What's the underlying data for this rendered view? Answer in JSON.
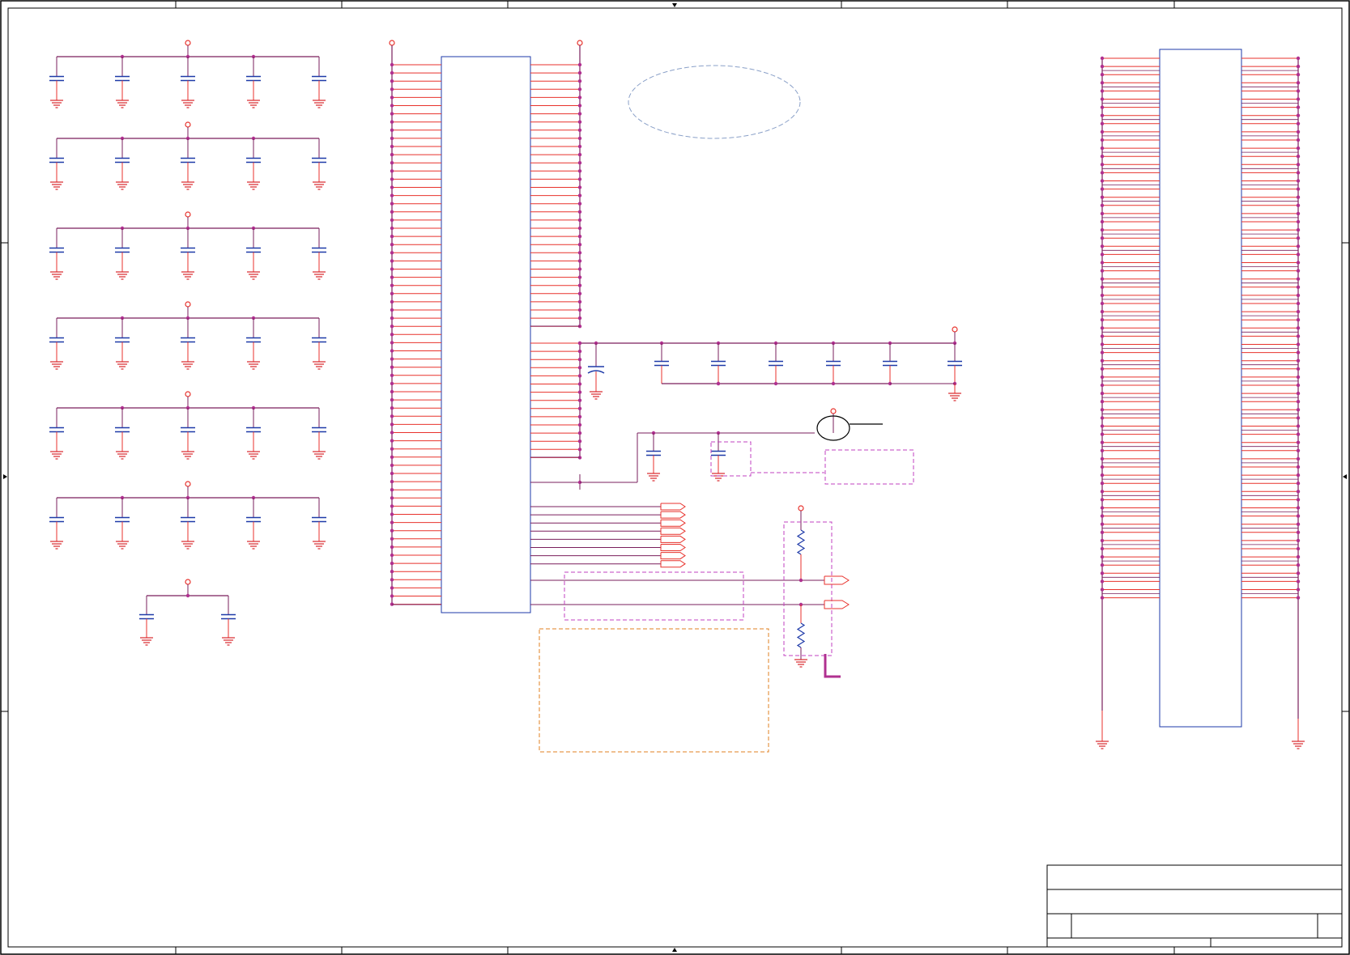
{
  "colors": {
    "frame": "#000000",
    "wire": "#7a1f5c",
    "pin": "#e8322c",
    "cap": "#1e3aa8",
    "ic": "#1e3aa8",
    "dot": "#b03090",
    "gnd": "#d9262a",
    "note_magenta": "#c040c0",
    "note_orange": "#e08020",
    "note_blue": "#8aa0c8",
    "marker": "#b03090"
  },
  "drawing": {
    "title_block": {
      "rows": 3,
      "filled_text": []
    },
    "bga_ic_pins_per_side": 67,
    "left_ic_pins_per_side": 67,
    "decoupling_groups": 6,
    "caps_per_group": 5,
    "bottom_group_caps": 2,
    "bus_caps": 6,
    "io_flags_column": 8,
    "output_flags": 2
  }
}
